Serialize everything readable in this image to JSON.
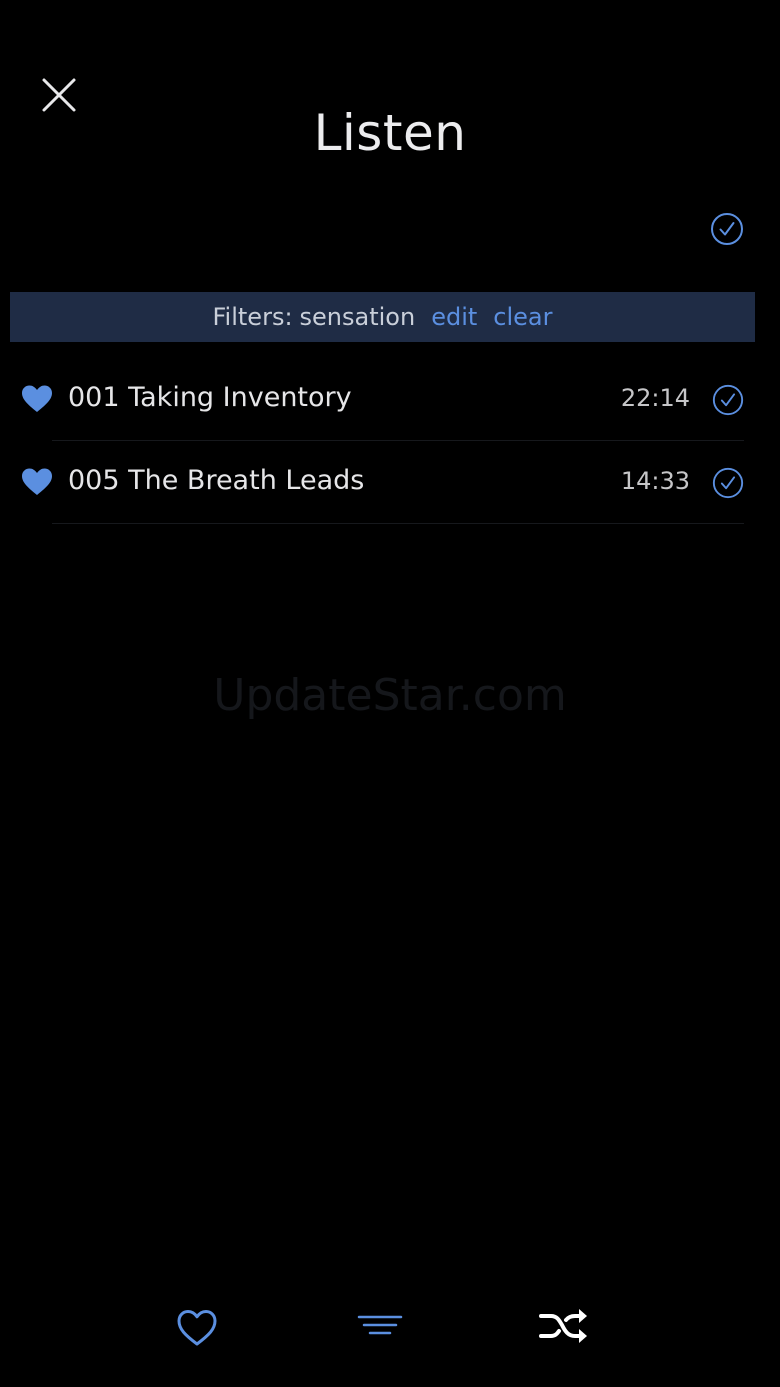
{
  "header": {
    "title": "Listen"
  },
  "filter": {
    "label": "Filters:",
    "value": "sensation",
    "edit_label": "edit",
    "clear_label": "clear"
  },
  "tracks": [
    {
      "title": "001 Taking Inventory",
      "duration": "22:14",
      "favorite": true,
      "checked": true
    },
    {
      "title": "005 The Breath Leads",
      "duration": "14:33",
      "favorite": true,
      "checked": true
    }
  ],
  "watermark": "UpdateStar.com",
  "icons": {
    "close": "close-icon",
    "select_all": "check-circle-icon",
    "favorite": "heart-icon",
    "check": "check-circle-icon",
    "tab_favorites": "heart-outline-icon",
    "tab_list": "list-lines-icon",
    "tab_shuffle": "shuffle-icon"
  },
  "colors": {
    "background": "#000000",
    "accent": "#5b8fe0",
    "filter_bar": "#1f2c45",
    "text": "#e6e6e8"
  }
}
